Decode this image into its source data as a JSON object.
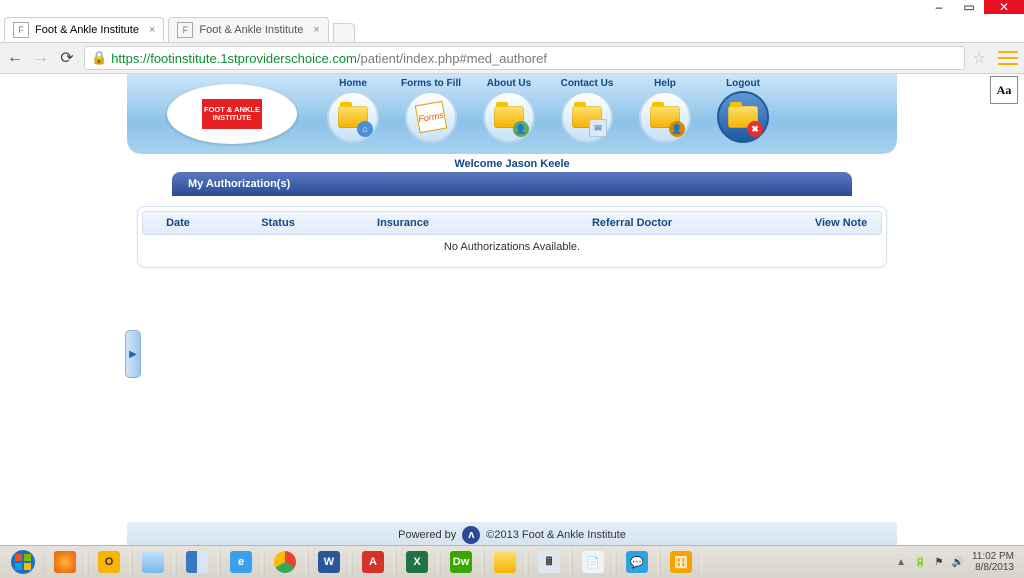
{
  "window": {
    "min": "–",
    "max": "▭",
    "close": "✕"
  },
  "tabs": [
    {
      "title": "Foot & Ankle Institute",
      "active": true
    },
    {
      "title": "Foot & Ankle Institute",
      "active": false
    }
  ],
  "url": {
    "protocol": "https://",
    "domain": "footinstitute.1stproviderschoice.com",
    "path": "/patient/index.php#med_authoref"
  },
  "accessibility": {
    "resize_label": "Aa"
  },
  "brand": {
    "logo_text": "FOOT & ANKLE INSTITUTE"
  },
  "nav": [
    {
      "key": "home",
      "label": "Home"
    },
    {
      "key": "forms",
      "label": "Forms to Fill",
      "paper": "Forms"
    },
    {
      "key": "about",
      "label": "About Us"
    },
    {
      "key": "contact",
      "label": "Contact Us"
    },
    {
      "key": "help",
      "label": "Help"
    },
    {
      "key": "logout",
      "label": "Logout"
    }
  ],
  "welcome": "Welcome Jason Keele",
  "section": {
    "title": "My Authorization(s)"
  },
  "columns": {
    "date": "Date",
    "status": "Status",
    "insurance": "Insurance",
    "doctor": "Referral Doctor",
    "note": "View Note"
  },
  "empty_message": "No Authorizations Available.",
  "footer": {
    "powered_by": "Powered by",
    "copyright": "©2013 Foot & Ankle Institute"
  },
  "taskbar": {
    "tray_chevron": "▲",
    "time": "11:02 PM",
    "date": "8/8/2013"
  }
}
